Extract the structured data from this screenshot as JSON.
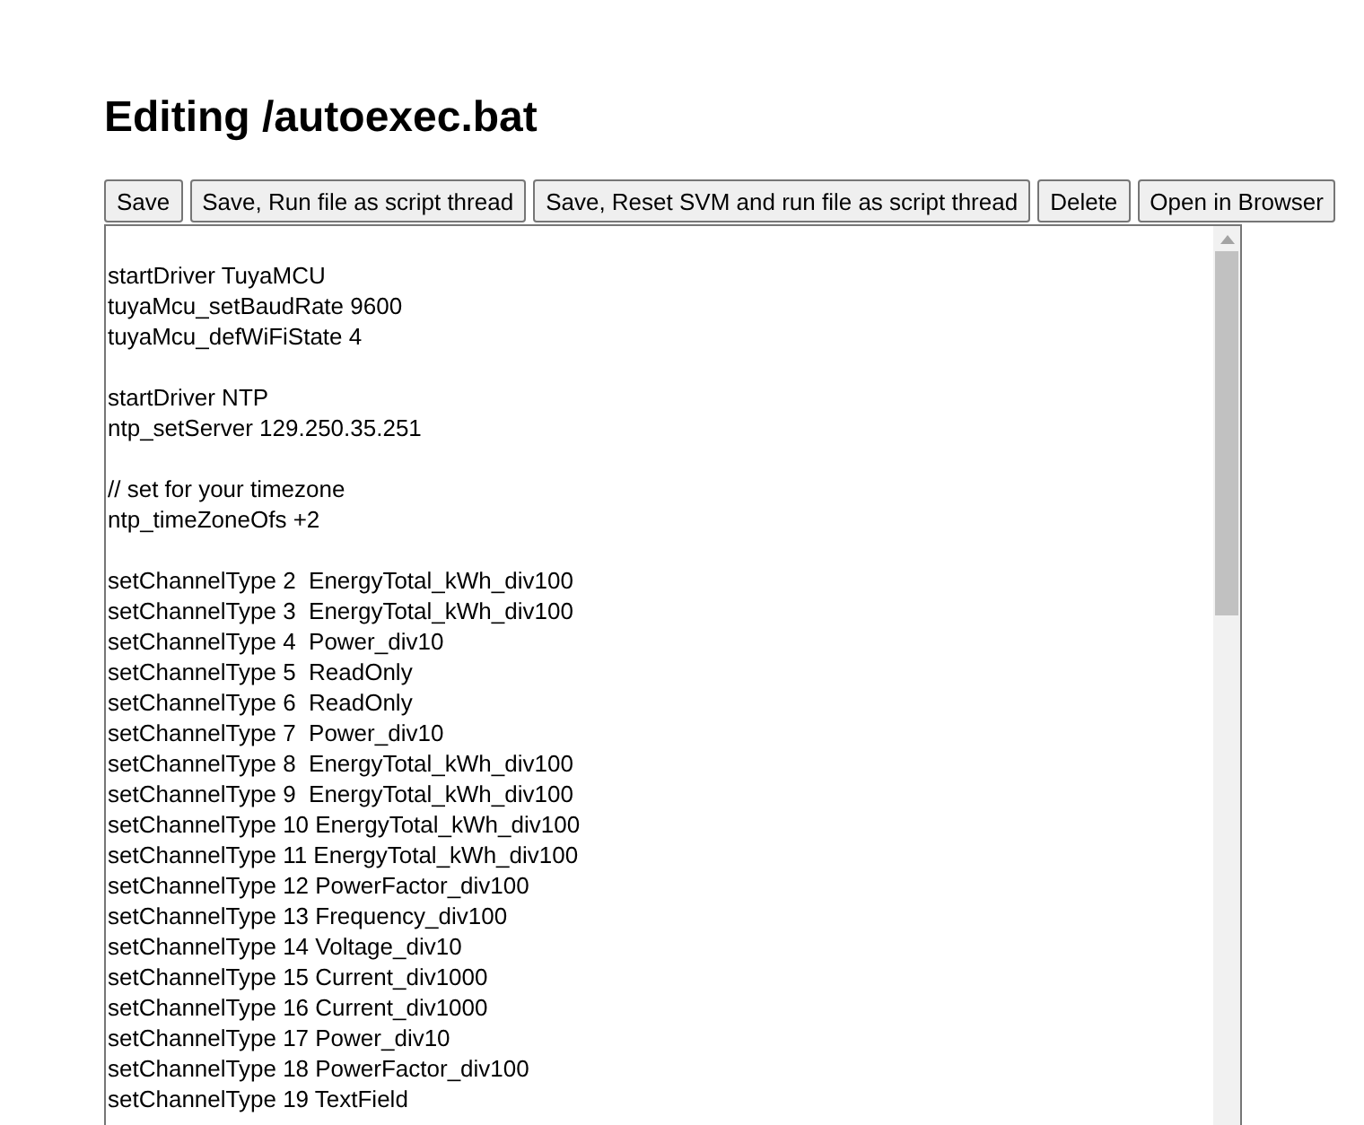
{
  "title": "Editing /autoexec.bat",
  "buttons": [
    "Save",
    "Save, Run file as script thread",
    "Save, Reset SVM and run file as script thread",
    "Delete",
    "Open in Browser"
  ],
  "editor": {
    "blocks": [
      [
        "startDriver TuyaMCU",
        "tuyaMcu_setBaudRate 9600",
        "tuyaMcu_defWiFiState 4"
      ],
      [
        "startDriver NTP",
        "ntp_setServer 129.250.35.251"
      ],
      [
        "// set for your timezone",
        "ntp_timeZoneOfs +2"
      ],
      [
        "setChannelType 2  EnergyTotal_kWh_div100",
        "setChannelType 3  EnergyTotal_kWh_div100",
        "setChannelType 4  Power_div10",
        "setChannelType 5  ReadOnly",
        "setChannelType 6  ReadOnly",
        "setChannelType 7  Power_div10",
        "setChannelType 8  EnergyTotal_kWh_div100",
        "setChannelType 9  EnergyTotal_kWh_div100",
        "setChannelType 10 EnergyTotal_kWh_div100",
        "setChannelType 11 EnergyTotal_kWh_div100",
        "setChannelType 12 PowerFactor_div100",
        "setChannelType 13 Frequency_div100",
        "setChannelType 14 Voltage_div10",
        "setChannelType 15 Current_div1000",
        "setChannelType 16 Current_div1000",
        "setChannelType 17 Power_div10",
        "setChannelType 18 PowerFactor_div100",
        "setChannelType 19 TextField"
      ]
    ]
  }
}
